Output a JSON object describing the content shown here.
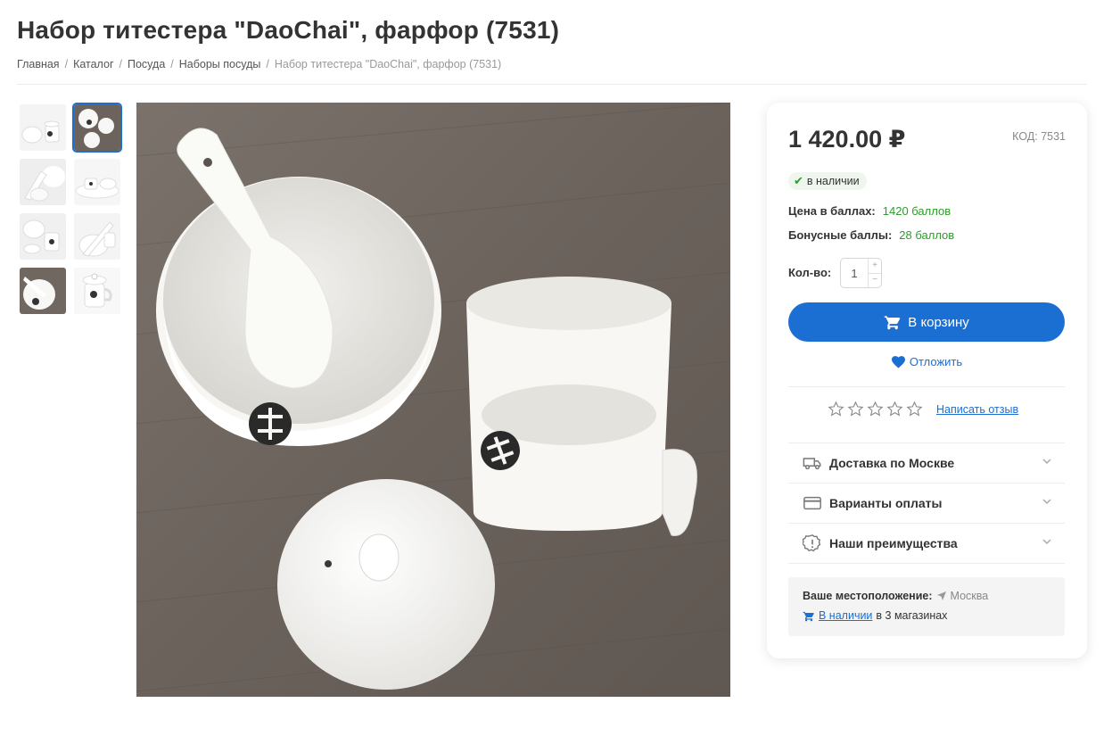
{
  "page": {
    "title": "Набор титестера \"DaoChai\", фарфор (7531)"
  },
  "breadcrumb": {
    "items": [
      "Главная",
      "Каталог",
      "Посуда",
      "Наборы посуды"
    ],
    "current": "Набор титестера \"DaoChai\", фарфор (7531)"
  },
  "gallery": {
    "thumbnail_count": 8,
    "active_index": 1
  },
  "product": {
    "price": "1 420.00",
    "currency": "₽",
    "code_label": "КОД:",
    "code_value": "7531",
    "stock": "в наличии",
    "points_label": "Цена в баллах:",
    "points_value": "1420 баллов",
    "bonus_label": "Бонусные баллы:",
    "bonus_value": "28 баллов",
    "qty_label": "Кол-во:",
    "qty_value": "1",
    "cart_button": "В корзину",
    "defer_link": "Отложить",
    "rating_stars": 0,
    "review_link": "Написать отзыв"
  },
  "accordion": [
    {
      "label": "Доставка по Москве",
      "icon": "truck-icon"
    },
    {
      "label": "Варианты оплаты",
      "icon": "card-icon"
    },
    {
      "label": "Наши преимущества",
      "icon": "alert-badge-icon"
    }
  ],
  "location": {
    "label": "Ваше местоположение:",
    "city": "Москва",
    "availability_link": "В наличии",
    "availability_rest": "в 3 магазинах"
  },
  "colors": {
    "accent": "#1b6fd2",
    "green": "#2b9c2b"
  }
}
